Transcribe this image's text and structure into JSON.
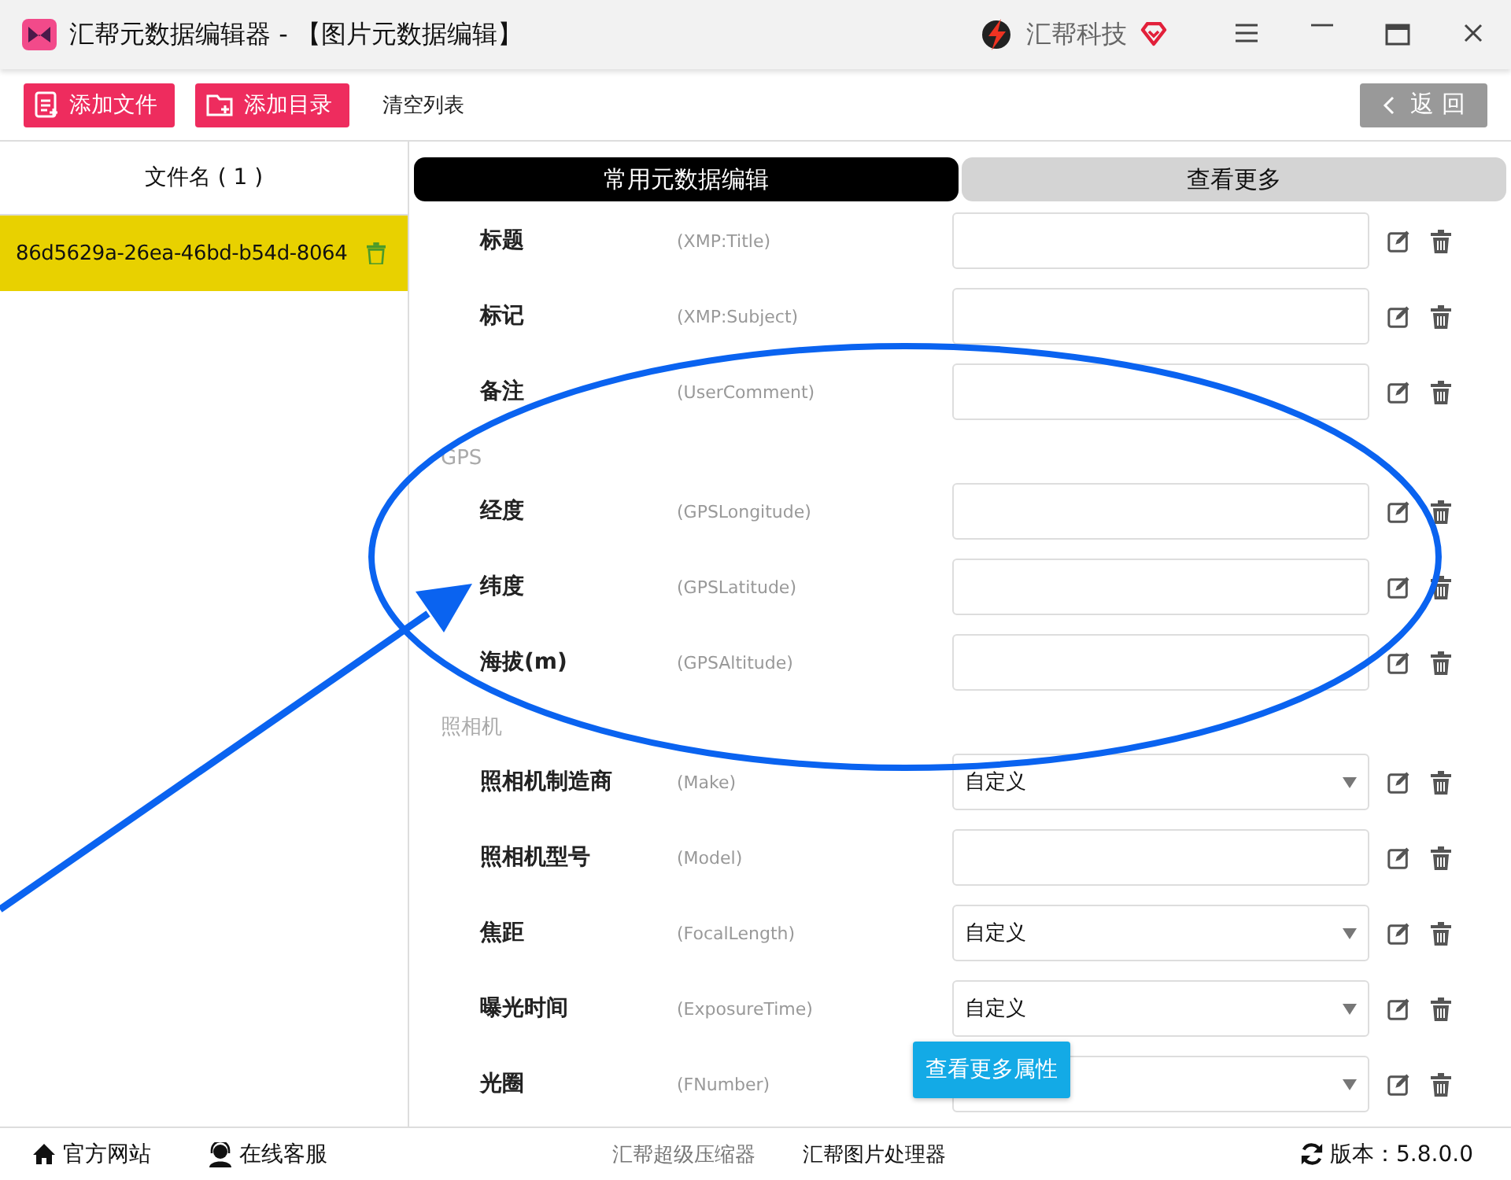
{
  "window": {
    "title": "汇帮元数据编辑器 - 【图片元数据编辑】",
    "brand": "汇帮科技"
  },
  "toolbar": {
    "buttons": [
      {
        "label": "添加文件",
        "kind": "file"
      },
      {
        "label": "添加目录",
        "kind": "folder"
      }
    ],
    "clear": "清空列表",
    "back": "返 回"
  },
  "file_list": {
    "header": "文件名 ( 1 )",
    "files": [
      {
        "name": "86d5629a-26ea-46bd-b54d-8064",
        "selected": true
      }
    ]
  },
  "tabs": [
    {
      "label": "常用元数据编辑",
      "selected": true
    },
    {
      "label": "查看更多",
      "selected": false
    }
  ],
  "fields": [
    {
      "kind": "input",
      "label": "标题",
      "tag": "(XMP:Title)"
    },
    {
      "kind": "input",
      "label": "标记",
      "tag": "(XMP:Subject)"
    },
    {
      "kind": "input",
      "label": "备注",
      "tag": "(UserComment)"
    },
    {
      "kind": "section",
      "label": "GPS"
    },
    {
      "kind": "input",
      "label": "经度",
      "tag": "(GPSLongitude)"
    },
    {
      "kind": "input",
      "label": "纬度",
      "tag": "(GPSLatitude)"
    },
    {
      "kind": "input",
      "label": "海拔(m)",
      "tag": "(GPSAltitude)"
    },
    {
      "kind": "section",
      "label": "照相机"
    },
    {
      "kind": "select",
      "label": "照相机制造商",
      "tag": "(Make)",
      "value": "自定义"
    },
    {
      "kind": "input",
      "label": "照相机型号",
      "tag": "(Model)"
    },
    {
      "kind": "select",
      "label": "焦距",
      "tag": "(FocalLength)",
      "value": "自定义"
    },
    {
      "kind": "select",
      "label": "曝光时间",
      "tag": "(ExposureTime)",
      "value": "自定义"
    },
    {
      "kind": "select",
      "label": "光圈",
      "tag": "(FNumber)"
    }
  ],
  "more_button": "查看更多属性",
  "status_bar": {
    "links": [
      {
        "label": "官方网站",
        "kind": "home"
      },
      {
        "label": "在线客服",
        "kind": "support"
      }
    ],
    "apps": [
      {
        "label": "汇帮超级压缩器",
        "selected": false
      },
      {
        "label": "汇帮图片处理器",
        "selected": true
      }
    ],
    "version": "版本：5.8.0.0"
  },
  "overlay": {
    "kind": "ellipse-arrow"
  }
}
